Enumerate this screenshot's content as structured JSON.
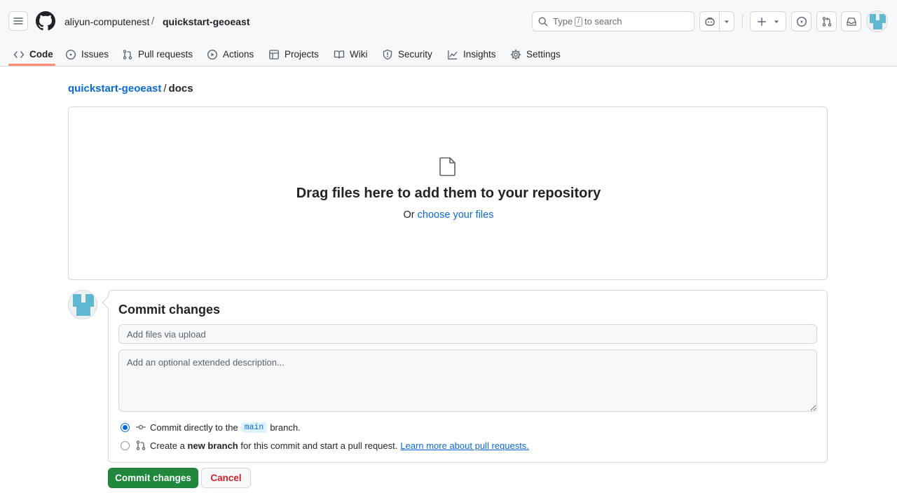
{
  "header": {
    "owner": "aliyun-computenest",
    "separator": "/",
    "repo": "quickstart-geoeast",
    "search": {
      "prefix": "Type",
      "key": "/",
      "suffix": "to search"
    }
  },
  "nav": {
    "tabs": [
      {
        "label": "Code",
        "icon": "code-icon",
        "active": true
      },
      {
        "label": "Issues",
        "icon": "issue-opened-icon"
      },
      {
        "label": "Pull requests",
        "icon": "git-pull-request-icon"
      },
      {
        "label": "Actions",
        "icon": "play-icon"
      },
      {
        "label": "Projects",
        "icon": "table-icon"
      },
      {
        "label": "Wiki",
        "icon": "book-icon"
      },
      {
        "label": "Security",
        "icon": "shield-icon"
      },
      {
        "label": "Insights",
        "icon": "graph-icon"
      },
      {
        "label": "Settings",
        "icon": "gear-icon"
      }
    ]
  },
  "path": {
    "repo": "quickstart-geoeast",
    "separator": "/",
    "folder": "docs"
  },
  "dropzone": {
    "title": "Drag files here to add them to your repository",
    "or": "Or",
    "choose": "choose your files"
  },
  "commit": {
    "title": "Commit changes",
    "summary_placeholder": "Add files via upload",
    "description_placeholder": "Add an optional extended description...",
    "option_direct": {
      "before": "Commit directly to the",
      "branch": "main",
      "after": "branch."
    },
    "option_new": {
      "before": "Create a",
      "bold": "new branch",
      "after": "for this commit and start a pull request.",
      "link": "Learn more about pull requests."
    },
    "commit_button": "Commit changes",
    "cancel_button": "Cancel"
  },
  "colors": {
    "accent": "#0969da",
    "primary_button": "#1f883d",
    "danger": "#cf222e",
    "tab_underline": "#fd8c73",
    "avatar": "#5fb7d0"
  }
}
